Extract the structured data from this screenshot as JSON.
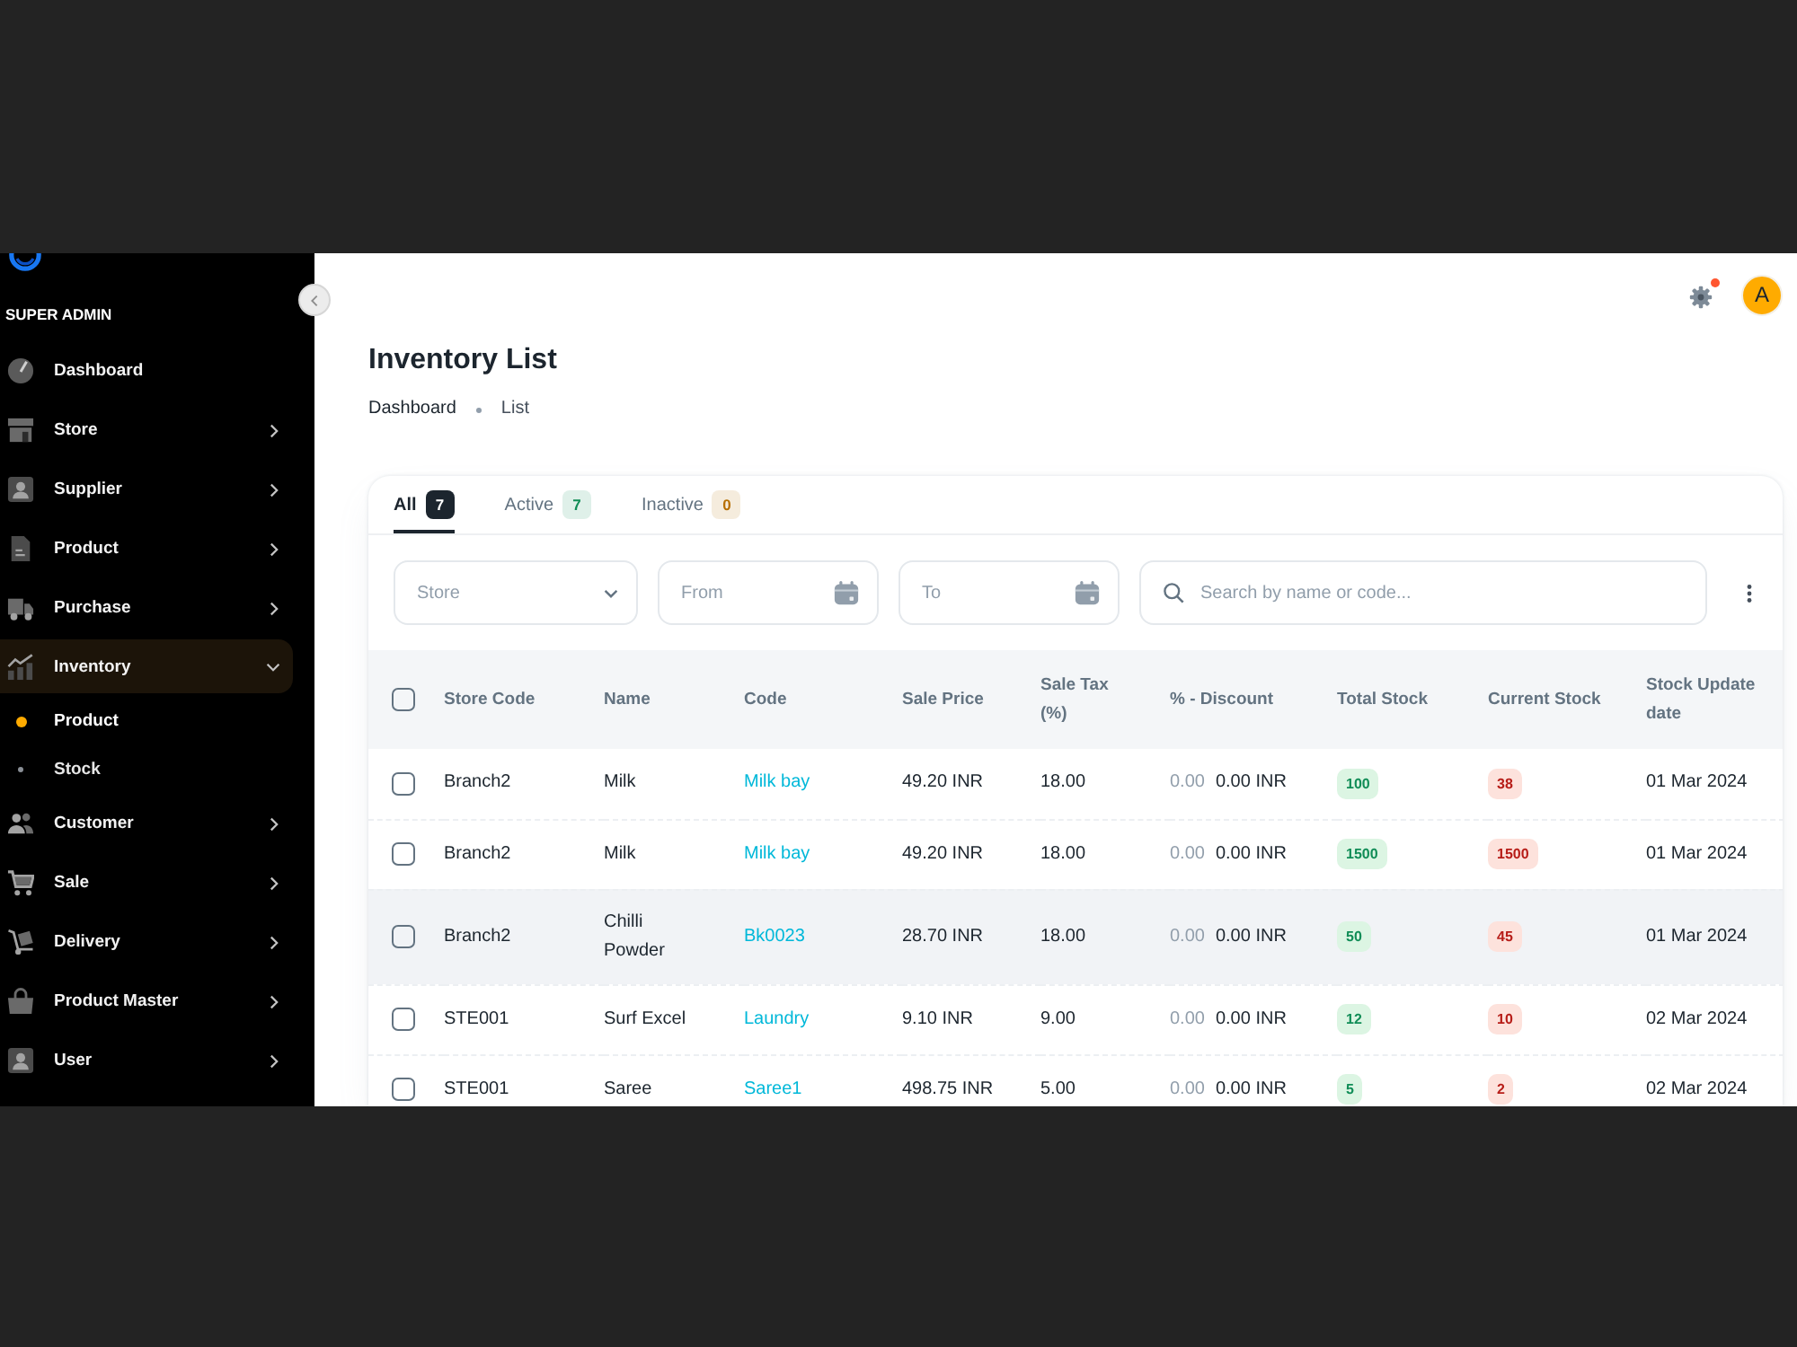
{
  "sidebar": {
    "role": "SUPER ADMIN",
    "items": [
      {
        "label": "Dashboard",
        "kind": "link"
      },
      {
        "label": "Store",
        "kind": "menu",
        "expanded": false
      },
      {
        "label": "Supplier",
        "kind": "menu",
        "expanded": false
      },
      {
        "label": "Product",
        "kind": "menu",
        "expanded": false
      },
      {
        "label": "Purchase",
        "kind": "menu",
        "expanded": false
      },
      {
        "label": "Inventory",
        "kind": "menu",
        "expanded": true,
        "children": [
          {
            "label": "Product",
            "selected": true
          },
          {
            "label": "Stock",
            "selected": false
          }
        ]
      },
      {
        "label": "Customer",
        "kind": "menu",
        "expanded": false
      },
      {
        "label": "Sale",
        "kind": "menu",
        "expanded": false
      },
      {
        "label": "Delivery",
        "kind": "menu",
        "expanded": false
      },
      {
        "label": "Product Master",
        "kind": "menu",
        "expanded": false
      },
      {
        "label": "User",
        "kind": "menu",
        "expanded": false
      }
    ]
  },
  "header": {
    "notification": true,
    "avatar": "A"
  },
  "page": {
    "title": "Inventory List",
    "breadcrumbs": [
      "Dashboard",
      "List"
    ]
  },
  "tabs": [
    {
      "label": "All",
      "count": "7",
      "selected": true,
      "color": "#1c252e"
    },
    {
      "label": "Active",
      "count": "7",
      "selected": false,
      "color": "#118d57"
    },
    {
      "label": "Inactive",
      "count": "0",
      "selected": false,
      "color": "#b76e00"
    }
  ],
  "filters": {
    "store": {
      "placeholder": "Store"
    },
    "from": {
      "placeholder": "From"
    },
    "to": {
      "placeholder": "To"
    },
    "search": {
      "placeholder": "Search by name or code..."
    }
  },
  "table": {
    "select_all": {
      "checked": false
    },
    "columns": [
      "Store Code",
      "Name",
      "Code",
      "Sale Price",
      "Sale Tax (%)",
      "% - Discount",
      "Total Stock",
      "Current Stock",
      "Stock Update date"
    ],
    "rows": [
      {
        "checked": false,
        "hovered": false,
        "store_code": "Branch2",
        "name": "Milk",
        "code": "Milk bay",
        "sale_price": "49.20 INR",
        "sale_tax": "18.00",
        "discount_percent": "0.00",
        "discount_amount": "0.00 INR",
        "total_stock": "100",
        "current_stock": "38",
        "updated": "01 Mar 2024"
      },
      {
        "checked": false,
        "hovered": false,
        "store_code": "Branch2",
        "name": "Milk",
        "code": "Milk bay",
        "sale_price": "49.20 INR",
        "sale_tax": "18.00",
        "discount_percent": "0.00",
        "discount_amount": "0.00 INR",
        "total_stock": "1500",
        "current_stock": "1500",
        "updated": "01 Mar 2024"
      },
      {
        "checked": false,
        "hovered": true,
        "store_code": "Branch2",
        "name": "Chilli Powder",
        "code": "Bk0023",
        "sale_price": "28.70 INR",
        "sale_tax": "18.00",
        "discount_percent": "0.00",
        "discount_amount": "0.00 INR",
        "total_stock": "50",
        "current_stock": "45",
        "updated": "01 Mar 2024"
      },
      {
        "checked": false,
        "hovered": false,
        "store_code": "STE001",
        "name": "Surf Excel",
        "code": "Laundry",
        "sale_price": "9.10 INR",
        "sale_tax": "9.00",
        "discount_percent": "0.00",
        "discount_amount": "0.00 INR",
        "total_stock": "12",
        "current_stock": "10",
        "updated": "02 Mar 2024"
      },
      {
        "checked": false,
        "hovered": false,
        "store_code": "STE001",
        "name": "Saree",
        "code": "Saree1",
        "sale_price": "498.75 INR",
        "sale_tax": "5.00",
        "discount_percent": "0.00",
        "discount_amount": "0.00 INR",
        "total_stock": "5",
        "current_stock": "2",
        "updated": "02 Mar 2024"
      }
    ]
  }
}
